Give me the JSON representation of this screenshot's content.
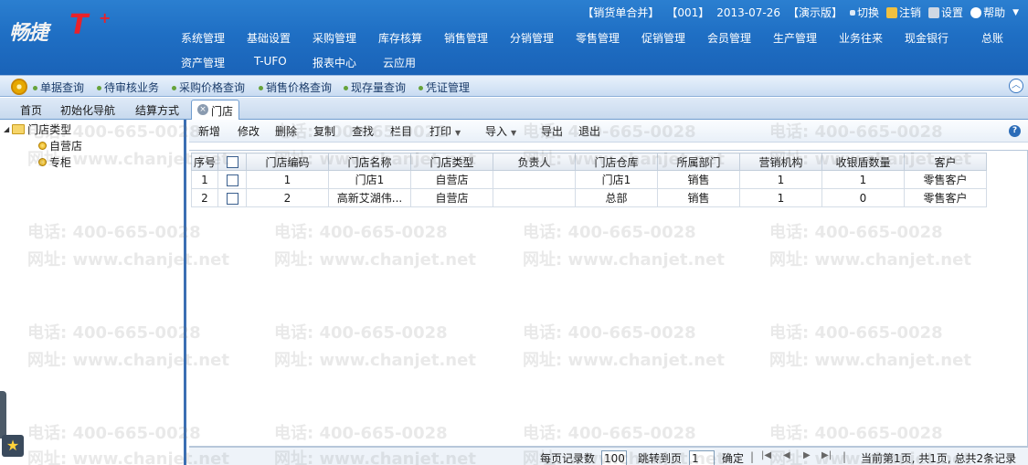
{
  "header": {
    "logo_text": "畅捷",
    "logo_t": "T",
    "logo_plus": "+",
    "account": "【销货单合并】",
    "code": "【001】",
    "date": "2013-07-26",
    "edition": "【演示版】",
    "switch": "切换",
    "logout": "注销",
    "settings": "设置",
    "help": "帮助"
  },
  "menu": {
    "row1": [
      "系统管理",
      "基础设置",
      "采购管理",
      "库存核算",
      "销售管理",
      "分销管理",
      "零售管理",
      "促销管理",
      "会员管理",
      "生产管理",
      "业务往来",
      "现金银行",
      "总账"
    ],
    "row2": [
      "资产管理",
      "T-UFO",
      "报表中心",
      "云应用"
    ]
  },
  "quick": [
    "单据查询",
    "待审核业务",
    "采购价格查询",
    "销售价格查询",
    "现存量查询",
    "凭证管理"
  ],
  "tabs": {
    "items": [
      "首页",
      "初始化导航",
      "结算方式"
    ],
    "active": "门店"
  },
  "tree": {
    "root": "门店类型",
    "children": [
      "自营店",
      "专柜"
    ]
  },
  "toolbar": [
    "新增",
    "修改",
    "删除",
    "复制",
    "查找",
    "栏目",
    "打印",
    "导入",
    "导出",
    "退出"
  ],
  "table": {
    "columns": [
      "序号",
      "",
      "门店编码",
      "门店名称",
      "门店类型",
      "负责人",
      "门店仓库",
      "所属部门",
      "营销机构",
      "收银盾数量",
      "客户"
    ],
    "rows": [
      [
        "1",
        "",
        "1",
        "门店1",
        "自营店",
        "",
        "门店1",
        "销售",
        "1",
        "1",
        "零售客户"
      ],
      [
        "2",
        "",
        "2",
        "高新艾湖伟...",
        "自营店",
        "",
        "总部",
        "销售",
        "1",
        "0",
        "零售客户"
      ]
    ]
  },
  "pager": {
    "per_page_label": "每页记录数",
    "per_page": "100",
    "jump_label": "跳转到页",
    "jump_value": "1",
    "confirm": "确定",
    "status": "当前第1页, 共1页, 总共2条记录"
  },
  "watermark": {
    "phone": "电话: 400-665-0028",
    "site": "网址: www.chanjet.net"
  }
}
